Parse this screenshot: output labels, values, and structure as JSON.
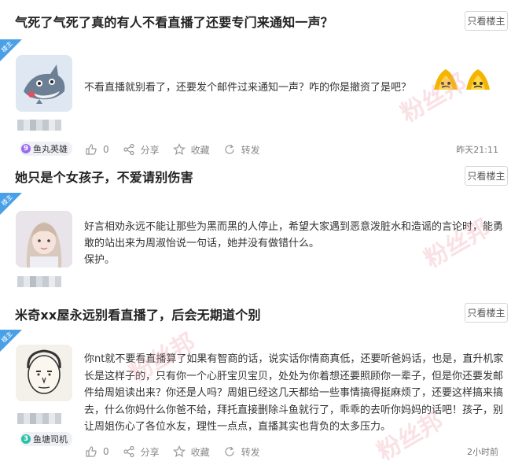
{
  "watermark": "粉丝邦",
  "posts": [
    {
      "title": "气死了气死了真的有人不看直播了还要专门来通知一声？",
      "only_op": "只看楼主",
      "corner_tag": "楼主",
      "body": "不看直播就别看了，还要发个邮件过来通知一声？咋的你是撤资了是吧？",
      "badge_level": "9",
      "badge_name": "鱼丸英雄",
      "like_count": "0",
      "share": "分享",
      "favorite": "收藏",
      "repost": "转发",
      "time": "昨天21:11"
    },
    {
      "title": "她只是个女孩子，不爱请别伤害",
      "only_op": "只看楼主",
      "corner_tag": "楼主",
      "body": "好言相劝永远不能让那些为黑而黑的人停止，希望大家遇到恶意泼脏水和造谣的言论时，能勇敢的站出来为周淑怡说一句话，她并没有做错什么。\n保护。"
    },
    {
      "title": "米奇xx屋永远别看直播了，后会无期道个别",
      "only_op": "只看楼主",
      "corner_tag": "楼主",
      "body": "你nt就不要看直播算了如果有智商的话，说实话你情商真低，还要听爸妈话，也是，直升机家长是这样子的，只有你一个心肝宝贝宝贝，处处为你着想还要照顾你一辈子，但是你还要发邮件给周姐读出来？你还是人吗？周姐已经这几天都给一些事情搞得挺麻烦了，还要这样搞来搞去，什么你妈什么你爸不给，拜托直接删除斗鱼就行了，乖乖的去听你妈妈的话吧！孩子，别让周姐伤心了各位水友，理性一点点，直播其实也背负的太多压力。",
      "badge_level": "3",
      "badge_name": "鱼塘司机",
      "like_count": "0",
      "share": "分享",
      "favorite": "收藏",
      "repost": "转发",
      "time": "2小时前"
    }
  ],
  "colors": {
    "corner": "#4aa0e6",
    "badge_lv9": "#9b6cf0",
    "badge_lv3": "#2bc0a6"
  }
}
